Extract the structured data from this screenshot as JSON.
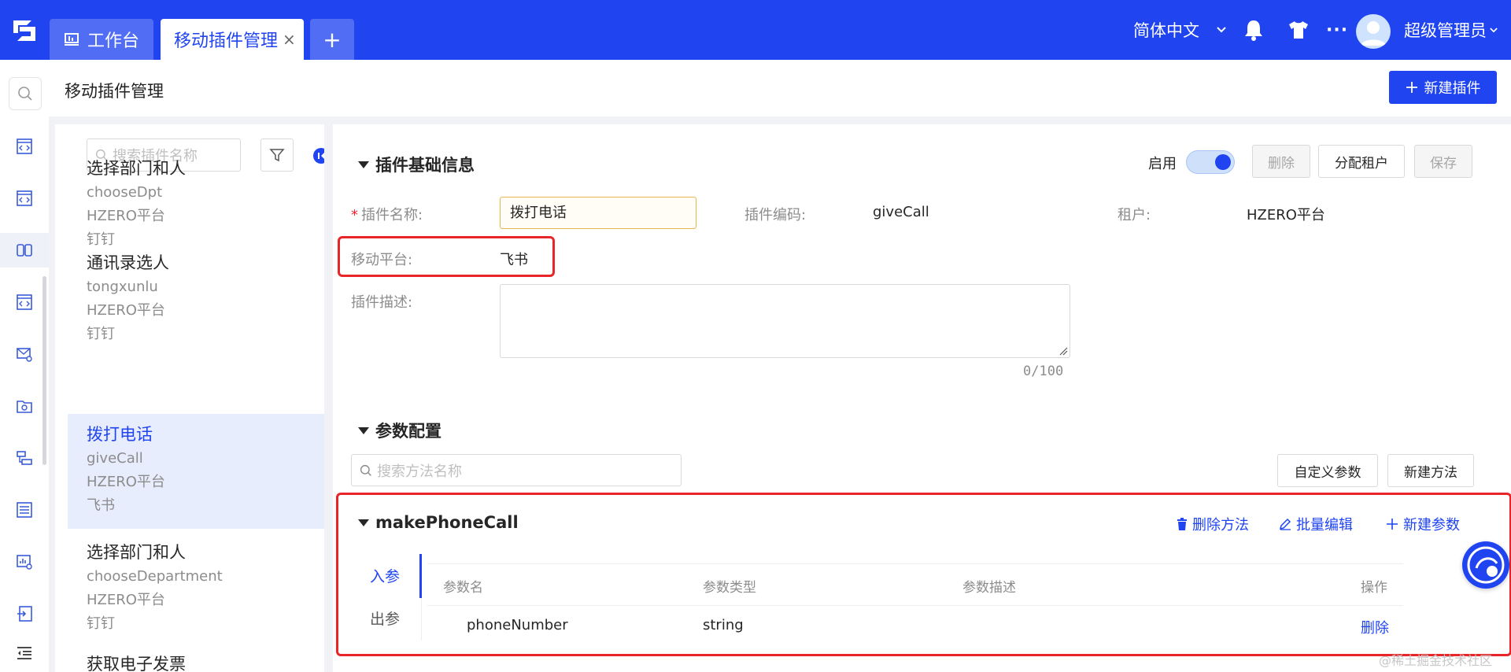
{
  "topbar": {
    "tabs": [
      {
        "label": "工作台"
      },
      {
        "label": "移动插件管理",
        "close": "×"
      }
    ],
    "add_tab": "+",
    "language": "简体中文",
    "more": "···",
    "username": "超级管理员"
  },
  "page": {
    "title": "移动插件管理",
    "new_button": "新建插件"
  },
  "list": {
    "search_placeholder": "搜索插件名称",
    "items": [
      {
        "name": "选择部门和人",
        "code": "chooseDpt",
        "tenant": "HZERO平台",
        "platform": "钉钉"
      },
      {
        "name": "通讯录选人",
        "code": "tongxunlu",
        "tenant": "HZERO平台",
        "platform": "钉钉"
      },
      {
        "name": "拨打电话",
        "code": "giveCall",
        "tenant": "HZERO平台",
        "platform": "飞书"
      },
      {
        "name": "选择部门和人",
        "code": "chooseDepartment",
        "tenant": "HZERO平台",
        "platform": "钉钉"
      },
      {
        "name": "获取电子发票",
        "code": "",
        "tenant": "",
        "platform": ""
      }
    ]
  },
  "detail": {
    "basic_title": "插件基础信息",
    "enable_label": "启用",
    "enabled": true,
    "buttons": {
      "delete": "删除",
      "assign": "分配租户",
      "save": "保存"
    },
    "fields": {
      "name_label": "插件名称:",
      "name_value": "拨打电话",
      "code_label": "插件编码:",
      "code_value": "giveCall",
      "tenant_label": "租户:",
      "tenant_value": "HZERO平台",
      "platform_label": "移动平台:",
      "platform_value": "飞书",
      "desc_label": "插件描述:",
      "desc_counter": "0/100"
    },
    "param_title": "参数配置",
    "method_search_placeholder": "搜索方法名称",
    "custom_param_button": "自定义参数",
    "new_method_button": "新建方法",
    "method": {
      "name": "makePhoneCall",
      "delete_method": "删除方法",
      "batch_edit": "批量编辑",
      "new_param": "新建参数",
      "tabs": {
        "input": "入参",
        "output": "出参"
      },
      "columns": [
        "参数名",
        "参数类型",
        "参数描述",
        "操作"
      ],
      "rows": [
        {
          "name": "phoneNumber",
          "type": "string",
          "desc": "",
          "action": "删除"
        }
      ]
    }
  },
  "watermark": "@稀土掘金技术社区",
  "colors": {
    "primary": "#1f44f0",
    "highlight": "#e8262a",
    "selected_bg": "#e8edfd"
  }
}
